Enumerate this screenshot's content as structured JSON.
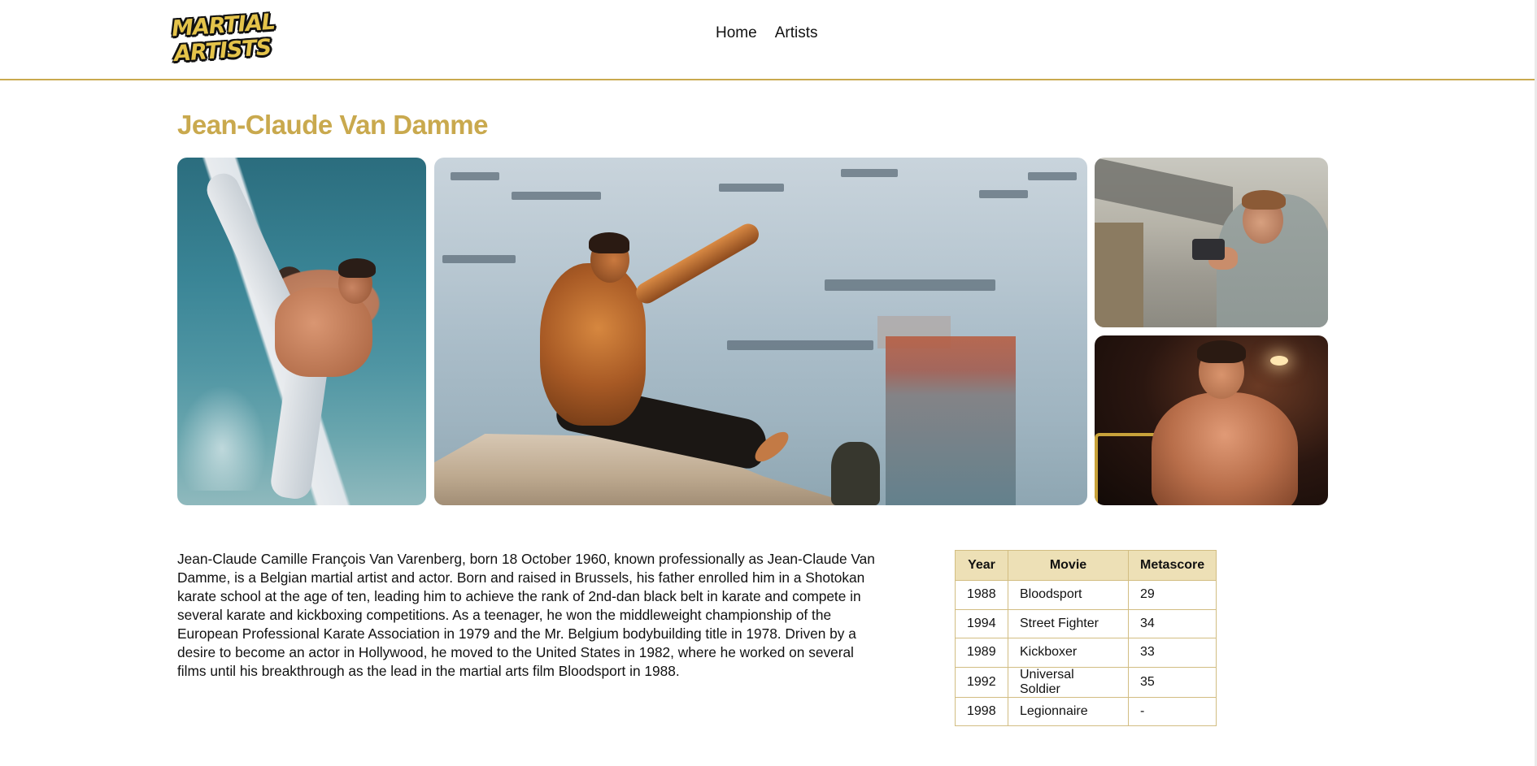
{
  "header": {
    "logo_line1": "MARTIAL",
    "logo_line2": "ARTISTS",
    "nav": [
      "Home",
      "Artists"
    ]
  },
  "page": {
    "title": "Jean-Claude Van Damme"
  },
  "gallery": {
    "photos": [
      {
        "name": "high-kick-in-water-photo"
      },
      {
        "name": "split-on-ledge-harbor-photo"
      },
      {
        "name": "aiming-pistol-photo"
      },
      {
        "name": "fighting-stance-photo"
      }
    ]
  },
  "bio": {
    "text": "Jean-Claude Camille François Van Varenberg, born 18 October 1960, known professionally as Jean-Claude Van Damme, is a Belgian martial artist and actor. Born and raised in Brussels, his father enrolled him in a Shotokan karate school at the age of ten, leading him to achieve the rank of 2nd-dan black belt in karate and compete in several karate and kickboxing competitions. As a teenager, he won the middleweight championship of the European Professional Karate Association in 1979 and the Mr. Belgium bodybuilding title in 1978. Driven by a desire to become an actor in Hollywood, he moved to the United States in 1982, where he worked on several films until his breakthrough as the lead in the martial arts film Bloodsport in 1988."
  },
  "movies": {
    "headers": [
      "Year",
      "Movie",
      "Metascore"
    ],
    "rows": [
      [
        "1988",
        "Bloodsport",
        "29"
      ],
      [
        "1994",
        "Street Fighter",
        "34"
      ],
      [
        "1989",
        "Kickboxer",
        "33"
      ],
      [
        "1992",
        "Universal Soldier",
        "35"
      ],
      [
        "1998",
        "Legionnaire",
        "-"
      ]
    ]
  },
  "colors": {
    "accent_gold": "#c9a94e",
    "table_header_bg": "#ede0b6",
    "table_border": "#d2bd82"
  }
}
